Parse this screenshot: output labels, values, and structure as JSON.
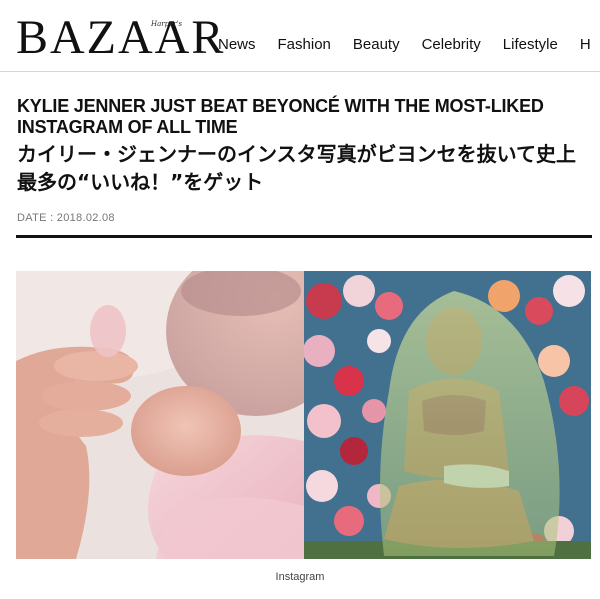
{
  "brand": {
    "small_label": "Harper's",
    "name": "BAZAAR"
  },
  "nav": {
    "items": [
      "News",
      "Fashion",
      "Beauty",
      "Celebrity",
      "Lifestyle",
      "H"
    ]
  },
  "article": {
    "headline_en": "KYLIE JENNER JUST BEAT BEYONCÉ WITH THE MOST-LIKED INSTAGRAM OF ALL TIME",
    "headline_jp": "カイリー・ジェンナーのインスタ写真がビヨンセを抜いて史上最多の“いいね！”をゲット",
    "date": "DATE : 2018.02.08",
    "image_caption": "Instagram"
  },
  "colors": {
    "text": "#111111",
    "date": "#777777",
    "rule": "#111111",
    "header_border": "#d6d6d6"
  }
}
